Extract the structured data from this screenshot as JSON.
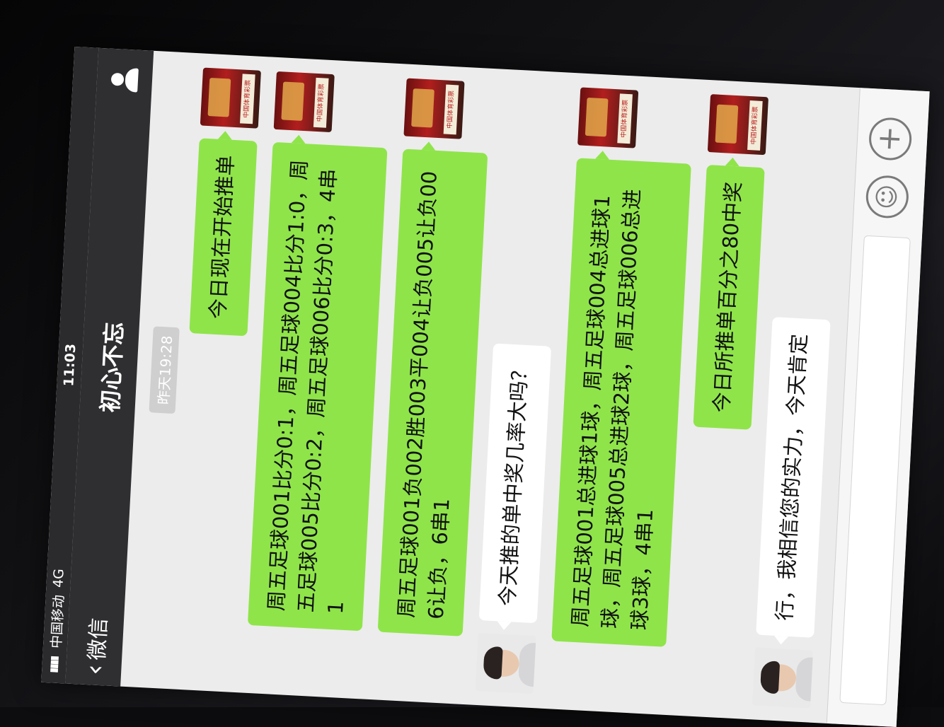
{
  "status_bar": {
    "signal": "▮▮▮▮",
    "carrier": "中国移动",
    "network": "4G",
    "time": "11:03"
  },
  "nav": {
    "back_label": "微信",
    "title": "初心不忘",
    "profile_icon": "person-icon"
  },
  "chat": {
    "timestamp": "昨天19:28",
    "messages": [
      {
        "side": "out",
        "text": "今日现在开始推单"
      },
      {
        "side": "out",
        "text": "周五足球001比分0:1，周五足球004比分1:0，周五足球005比分0:2，周五足球006比分0:3，4串1"
      },
      {
        "side": "out",
        "text": "周五足球001负002胜003平004让负005让负006让负，6串1"
      },
      {
        "side": "in",
        "text": "今天推的单中奖几率大吗？"
      },
      {
        "side": "out",
        "text": "周五足球001总进球1球，周五足球004总进球1球，周五足球005总进球2球，周五足球006总进球3球，4串1"
      },
      {
        "side": "out",
        "text": "今日所推单百分之80中奖"
      },
      {
        "side": "in",
        "text": "行，我相信您的实力，今天肯定"
      }
    ]
  },
  "shop_avatar_sign": "中国体育彩票",
  "input_bar": {
    "emoji_icon": "emoji-icon",
    "plus_icon": "plus-icon",
    "emoji_glyph": "☺",
    "plus_glyph": "+"
  },
  "colors": {
    "outgoing_bubble": "#8fe44a",
    "incoming_bubble": "#ffffff",
    "nav_bar": "#2f2f32"
  }
}
